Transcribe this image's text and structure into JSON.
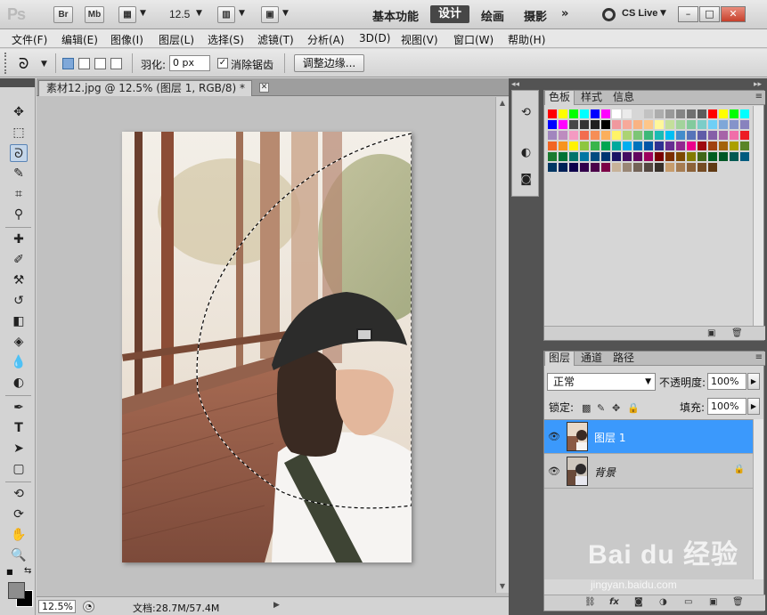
{
  "titlebar": {
    "logo": "Ps",
    "bridge": "Br",
    "minibridge": "Mb",
    "zoom": "12.5",
    "workspaces": [
      {
        "label": "基本功能",
        "active": false
      },
      {
        "label": "设计",
        "active": true
      },
      {
        "label": "绘画",
        "active": false
      },
      {
        "label": "摄影",
        "active": false
      }
    ],
    "more": "»",
    "cs_live": "CS Live",
    "win_min": "–",
    "win_max": "□",
    "win_close": "✕"
  },
  "menu": [
    "文件(F)",
    "编辑(E)",
    "图像(I)",
    "图层(L)",
    "选择(S)",
    "滤镜(T)",
    "分析(A)",
    "3D(D)",
    "视图(V)",
    "窗口(W)",
    "帮助(H)"
  ],
  "options": {
    "feather_label": "羽化:",
    "feather_value": "0 px",
    "antialias_label": "消除锯齿",
    "antialias_checked": "✓",
    "refine_edge": "调整边缘..."
  },
  "document": {
    "tab_title": "素材12.jpg @ 12.5% (图层 1, RGB/8) *",
    "close": "✕",
    "zoom": "12.5%",
    "doc_info": "文档:28.7M/57.4M"
  },
  "swatches_panel": {
    "tabs": [
      {
        "label": "色板",
        "active": true
      },
      {
        "label": "样式",
        "active": false
      },
      {
        "label": "信息",
        "active": false
      }
    ],
    "colors": [
      "#ff0000",
      "#ffff00",
      "#00ff00",
      "#00ffff",
      "#0000ff",
      "#ff00ff",
      "#ffffff",
      "#ebebeb",
      "#d6d6d6",
      "#c2c2c2",
      "#adadad",
      "#999999",
      "#858585",
      "#707070",
      "#5c5c5c",
      "#ff0000",
      "#ffff00",
      "#00ff00",
      "#00ffff",
      "#0000ff",
      "#ff00ff",
      "#474747",
      "#333333",
      "#1f1f1f",
      "#000000",
      "#f0989e",
      "#f7a99a",
      "#f9b383",
      "#fdc689",
      "#fff79a",
      "#c4df9b",
      "#a2d39c",
      "#82ca9d",
      "#7bcdc8",
      "#6ecff6",
      "#7ea7d8",
      "#8493ca",
      "#8882be",
      "#a186be",
      "#bd8cbf",
      "#f49ac2",
      "#f26c4f",
      "#f68e56",
      "#fbaf5c",
      "#fff467",
      "#acd373",
      "#7cc576",
      "#3cb878",
      "#1abbb4",
      "#00bff3",
      "#448ccb",
      "#5674b9",
      "#605ca8",
      "#855fa8",
      "#a763a8",
      "#f06ea9",
      "#ed1c24",
      "#f26522",
      "#f7941d",
      "#fff200",
      "#8dc63f",
      "#39b54a",
      "#00a651",
      "#00a99d",
      "#00aeef",
      "#0072bc",
      "#0054a6",
      "#2e3192",
      "#662d91",
      "#92278f",
      "#ec008c",
      "#9e0b0f",
      "#a0410d",
      "#a36209",
      "#aba000",
      "#598527",
      "#1a7b30",
      "#007236",
      "#00746b",
      "#0076a3",
      "#004b80",
      "#003471",
      "#1b1464",
      "#440e62",
      "#630460",
      "#9e005d",
      "#790000",
      "#7b2e00",
      "#7d4900",
      "#827b00",
      "#406618",
      "#005e20",
      "#005826",
      "#005952",
      "#005b7f",
      "#003663",
      "#002157",
      "#0d004c",
      "#32004b",
      "#4b0049",
      "#7b0046",
      "#c7b299",
      "#998675",
      "#736357",
      "#534741",
      "#37302a",
      "#c69c6d",
      "#a67c52",
      "#8c6239",
      "#754c24",
      "#603913"
    ]
  },
  "layers_panel": {
    "tabs": [
      {
        "label": "图层",
        "active": true
      },
      {
        "label": "通道",
        "active": false
      },
      {
        "label": "路径",
        "active": false
      }
    ],
    "blend_mode": "正常",
    "opacity_label": "不透明度:",
    "opacity": "100%",
    "lock_label": "锁定:",
    "fill_label": "填充:",
    "fill": "100%",
    "layers": [
      {
        "name": "图层 1",
        "selected": true,
        "locked": false
      },
      {
        "name": "背景",
        "selected": false,
        "locked": true
      }
    ]
  },
  "watermark": {
    "brand": "Bai du 经验",
    "url": "jingyan.baidu.com"
  }
}
